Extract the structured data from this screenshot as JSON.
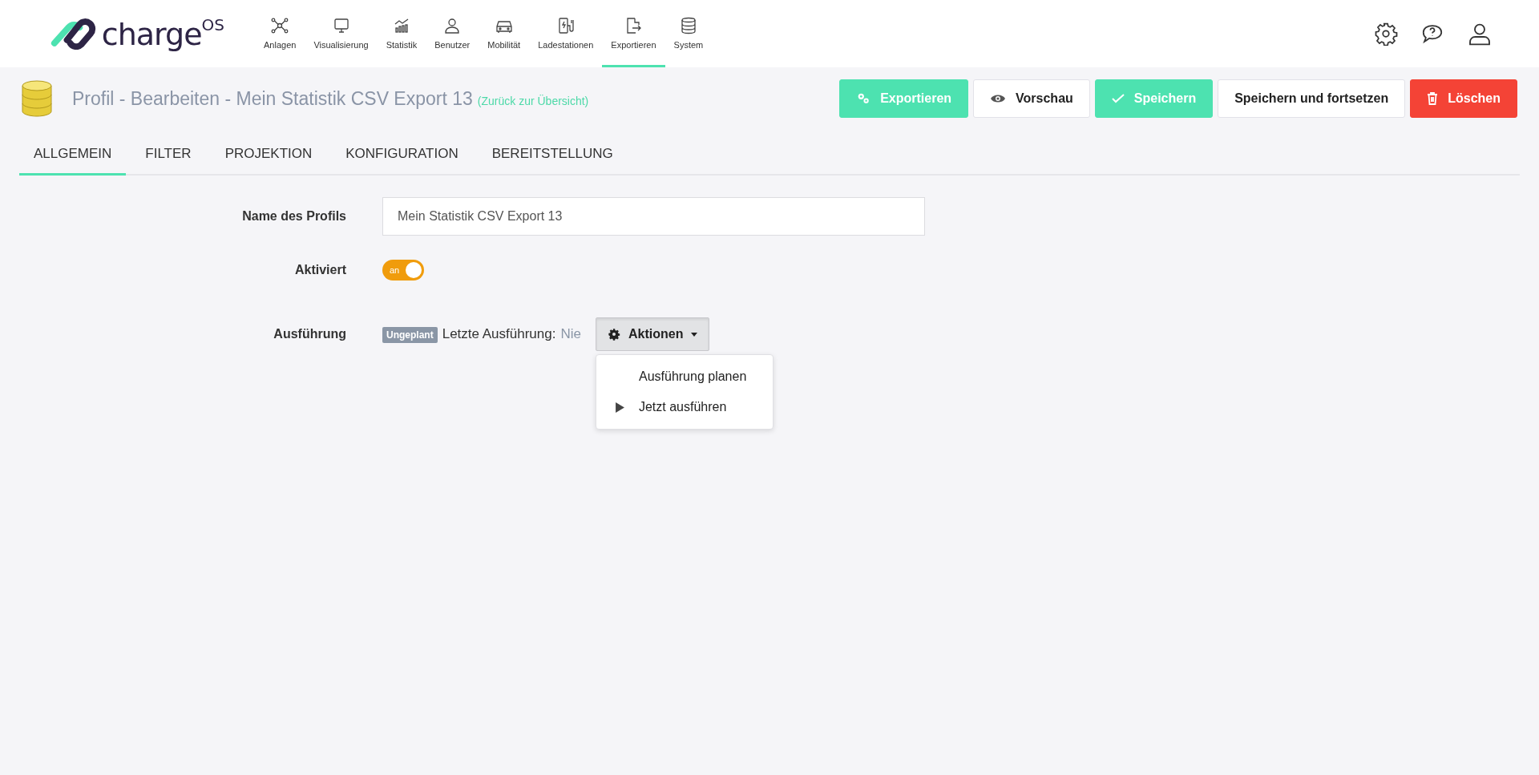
{
  "logo": {
    "text": "charge",
    "superscript": "OS"
  },
  "nav": [
    {
      "label": "Anlagen",
      "selected": false
    },
    {
      "label": "Visualisierung",
      "selected": false
    },
    {
      "label": "Statistik",
      "selected": false
    },
    {
      "label": "Benutzer",
      "selected": false
    },
    {
      "label": "Mobilität",
      "selected": false
    },
    {
      "label": "Ladestationen",
      "selected": false
    },
    {
      "label": "Exportieren",
      "selected": true
    },
    {
      "label": "System",
      "selected": false
    }
  ],
  "page": {
    "title": "Profil - Bearbeiten - Mein Statistik CSV Export 13",
    "back_link": "(Zurück zur Übersicht)"
  },
  "actions": [
    {
      "label": "Exportieren",
      "kind": "primary"
    },
    {
      "label": "Vorschau",
      "kind": "secondary"
    },
    {
      "label": "Speichern",
      "kind": "primary"
    },
    {
      "label": "Speichern und fortsetzen",
      "kind": "secondary"
    },
    {
      "label": "Löschen",
      "kind": "danger"
    }
  ],
  "tabs": [
    {
      "label": "ALLGEMEIN",
      "selected": true
    },
    {
      "label": "FILTER",
      "selected": false
    },
    {
      "label": "PROJEKTION",
      "selected": false
    },
    {
      "label": "KONFIGURATION",
      "selected": false
    },
    {
      "label": "BEREITSTELLUNG",
      "selected": false
    }
  ],
  "form": {
    "name": {
      "label": "Name des Profils",
      "value": "Mein Statistik CSV Export 13"
    },
    "enabled": {
      "label": "Aktiviert",
      "on": true,
      "text": "an"
    },
    "execution": {
      "label": "Ausführung",
      "badge": "Ungeplant",
      "last_label": "Letzte Ausführung:",
      "last_value": "Nie",
      "button": "Aktionen",
      "expanded": true,
      "menu": [
        {
          "label": "Ausführung planen",
          "kind": "plain"
        },
        {
          "label": "Jetzt ausführen",
          "kind": "run"
        }
      ]
    }
  }
}
